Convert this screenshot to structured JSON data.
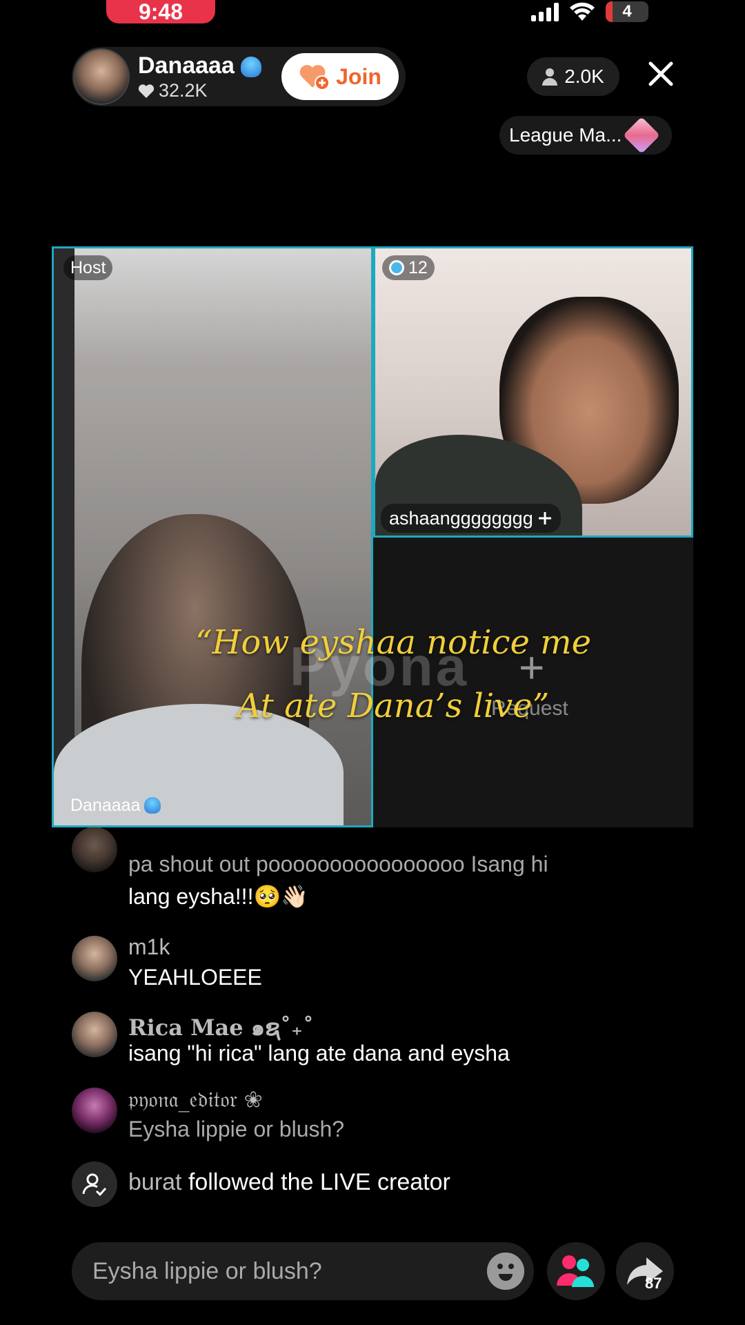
{
  "status_bar": {
    "time": "9:48",
    "battery": "4"
  },
  "host": {
    "name": "Danaaaa",
    "likes": "32.2K",
    "join_label": "Join"
  },
  "viewers": "2.0K",
  "league": "League Ma...",
  "grid": {
    "host_tag": "Host",
    "host_name": "Danaaaa",
    "guest_badge": "12",
    "guest_name": "ashaangggggggg",
    "request_label": "Request",
    "watermark": "Pyona"
  },
  "overlay_quote": {
    "line1": "“How eyshaa notice me",
    "line2": "At ate Dana’s live”"
  },
  "comments": [
    {
      "line1": "pa shout out poooooooooooooooo Isang hi",
      "line2": "lang eysha!!!🥺👋🏻"
    },
    {
      "name": "m1k",
      "text": "YEAHLOEEE"
    },
    {
      "name": "Rica Mae ๑ຊ˚₊˚",
      "text": "isang \"hi rica\" lang ate dana and eysha"
    },
    {
      "name": "𝔭𝔶𝔬𝔫𝔞_𝔢𝔡𝔦𝔱𝔬𝔯 ❀",
      "text": "Eysha lippie or blush?"
    }
  ],
  "follow_event": {
    "user": "burat",
    "text": "followed the LIVE creator"
  },
  "bottom_bar": {
    "input_value": "Eysha lippie or blush?",
    "share_count": "87"
  },
  "colors": {
    "accent_border": "#1fa8c0",
    "quote_yellow": "#f0cf3a",
    "join_orange": "#f0662b",
    "status_red": "#e8334a"
  }
}
